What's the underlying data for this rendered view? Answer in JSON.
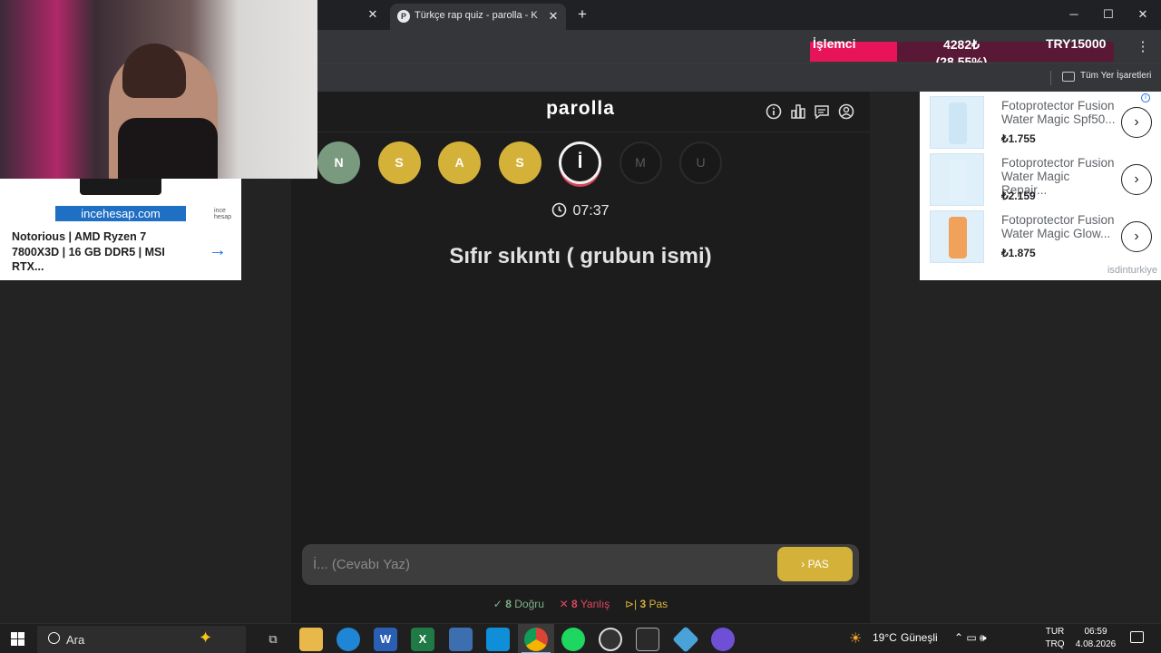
{
  "browser": {
    "tab_title": "Türkçe rap quiz - parolla - K",
    "tab_favicon": "P",
    "close_glyph": "✕",
    "new_tab_glyph": "+",
    "window_minimize": "─",
    "window_maximize": "☐",
    "window_close": "✕",
    "bookmarks_label": "Tüm Yer İşaretleri",
    "menu_glyph": "⋮"
  },
  "cpu_widget": {
    "label": "İşlemci",
    "value": "4282₺",
    "percent_text": "(28.55%)",
    "target": "TRY15000",
    "percent": 28.55,
    "fill_color": "#e8145a"
  },
  "game": {
    "logo": "parolla",
    "header_icons": [
      "info-icon",
      "stats-icon",
      "chat-icon",
      "profile-icon"
    ],
    "letters": [
      {
        "char": "N",
        "state": "correct"
      },
      {
        "char": "S",
        "state": "done"
      },
      {
        "char": "A",
        "state": "done"
      },
      {
        "char": "S",
        "state": "done"
      },
      {
        "char": "İ",
        "state": "current"
      },
      {
        "char": "M",
        "state": "pending"
      },
      {
        "char": "U",
        "state": "pending"
      }
    ],
    "timer": "07:37",
    "question": "Sıfır sıkıntı ( grubun ismi)",
    "answer_placeholder": "İ... (Cevabı Yaz)",
    "pass_label": "PAS",
    "stats": {
      "correct_icon": "✓",
      "correct_count": "8",
      "correct_label": "Doğru",
      "wrong_icon": "✕",
      "wrong_count": "8",
      "wrong_label": "Yanlış",
      "pass_icon": "⊳|",
      "pass_count": "3",
      "pass_label": "Pas"
    },
    "colors": {
      "correct": "#7a9a80",
      "done": "#d4b23a",
      "wrong": "#d6455a",
      "accent": "#d4b23a"
    }
  },
  "left_ad": {
    "brand": "incehesap.com",
    "brand_small": "ince hesap",
    "text": "Notorious | AMD Ryzen 7 7800X3D | 16 GB DDR5 | MSI RTX...",
    "arrow": "→"
  },
  "right_ad": {
    "info_glyph": "i",
    "products": [
      {
        "name": "Fotoprotector Fusion Water Magic Spf50...",
        "price": "₺1.755",
        "bottle_color": "#cde6f5"
      },
      {
        "name": "Fotoprotector Fusion Water Magic Repair...",
        "price": "₺2.159",
        "bottle_color": "#e3f1fb"
      },
      {
        "name": "Fotoprotector Fusion Water Magic Glow...",
        "price": "₺1.875",
        "bottle_color": "#f0a15a"
      }
    ],
    "go_glyph": "›",
    "source": "isdinturkiye"
  },
  "taskbar": {
    "search_label": "Ara",
    "sparkle": "✦",
    "weather_temp": "19°C",
    "weather_text": "Güneşli",
    "lang_top": "TUR",
    "lang_bottom": "TRQ",
    "time": "06:59",
    "date": "4.08.2026",
    "tray_glyphs": "⌃  ▭  🕪"
  }
}
